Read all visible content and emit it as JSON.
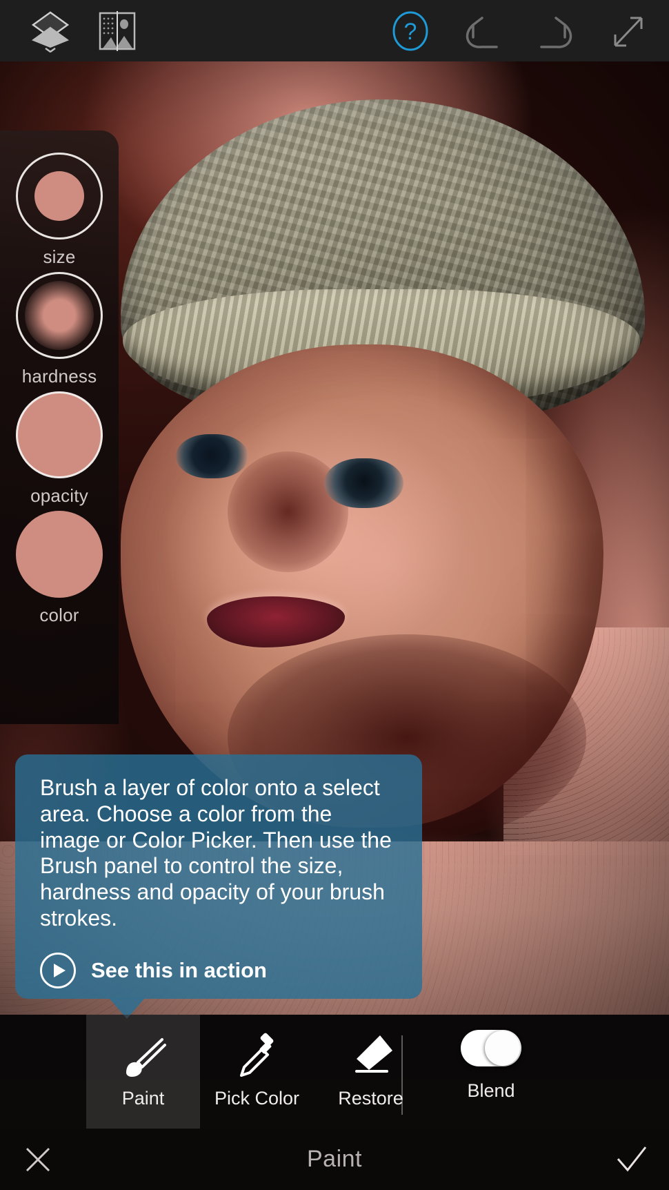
{
  "topbar": {
    "layers_icon": "layers-icon",
    "compare_icon": "before-after-image-icon",
    "help_icon": "help-question-icon",
    "undo_icon": "undo-arrow-icon",
    "redo_icon": "redo-arrow-icon",
    "fullscreen_icon": "fullscreen-expand-icon",
    "help_accent_color": "#1e9ad6"
  },
  "brush_panel": {
    "brush_color": "#cf8d81",
    "items": [
      {
        "label": "size",
        "kind": "ring-dot"
      },
      {
        "label": "hardness",
        "kind": "ring-soft"
      },
      {
        "label": "opacity",
        "kind": "filled"
      },
      {
        "label": "color",
        "kind": "filled"
      }
    ]
  },
  "tooltip": {
    "body": "Brush a layer of color onto a select area. Choose a color from the image or Color Picker. Then use the Brush panel to control the size, hardness and opacity of your brush strokes.",
    "cta_label": "See this in action",
    "cta_icon": "play-circle-icon",
    "background_color": "#2870 96"
  },
  "toolbar": {
    "tools": [
      {
        "label": "Paint",
        "icon": "paintbrush-icon",
        "selected": true
      },
      {
        "label": "Pick Color",
        "icon": "eyedropper-icon",
        "selected": false
      },
      {
        "label": "Restore",
        "icon": "eraser-icon",
        "selected": false
      }
    ],
    "blend": {
      "label": "Blend",
      "enabled": false,
      "icon": "toggle-switch"
    }
  },
  "bottombar": {
    "cancel_icon": "close-x-icon",
    "title": "Paint",
    "confirm_icon": "checkmark-icon"
  }
}
